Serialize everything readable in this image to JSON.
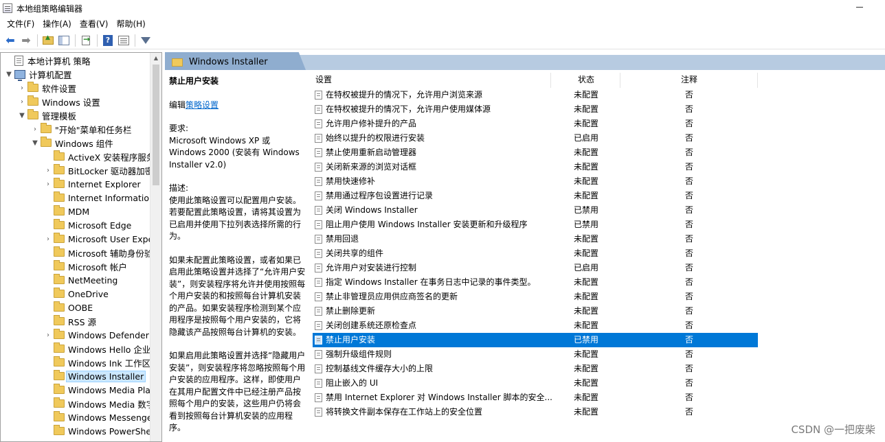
{
  "window": {
    "title": "本地组策略编辑器"
  },
  "menu": [
    "文件(F)",
    "操作(A)",
    "查看(V)",
    "帮助(H)"
  ],
  "toolbar": {
    "icons": [
      "back-arrow-icon",
      "forward-arrow-icon",
      "folder-up-icon",
      "show-hide-tree-icon",
      "export-list-icon",
      "help-icon",
      "properties-icon",
      "filter-icon"
    ]
  },
  "tree": [
    {
      "label": "本地计算机 策略",
      "icon": "doc",
      "expander": ""
    },
    {
      "label": "计算机配置",
      "icon": "pc",
      "expander": "▼"
    },
    {
      "label": "软件设置",
      "icon": "folder",
      "expander": "›"
    },
    {
      "label": "Windows 设置",
      "icon": "folder",
      "expander": "›"
    },
    {
      "label": "管理模板",
      "icon": "folder",
      "expander": "▼"
    },
    {
      "label": "\"开始\"菜单和任务栏",
      "icon": "folder",
      "expander": "›"
    },
    {
      "label": "Windows 组件",
      "icon": "folder",
      "expander": "▼"
    },
    {
      "label": "ActiveX 安装程序服务",
      "icon": "folder",
      "expander": ""
    },
    {
      "label": "BitLocker 驱动器加密",
      "icon": "folder",
      "expander": "›"
    },
    {
      "label": "Internet Explorer",
      "icon": "folder",
      "expander": "›"
    },
    {
      "label": "Internet Information",
      "icon": "folder",
      "expander": ""
    },
    {
      "label": "MDM",
      "icon": "folder",
      "expander": ""
    },
    {
      "label": "Microsoft Edge",
      "icon": "folder",
      "expander": ""
    },
    {
      "label": "Microsoft User Expe",
      "icon": "folder",
      "expander": "›"
    },
    {
      "label": "Microsoft 辅助身份验",
      "icon": "folder",
      "expander": ""
    },
    {
      "label": "Microsoft 帐户",
      "icon": "folder",
      "expander": ""
    },
    {
      "label": "NetMeeting",
      "icon": "folder",
      "expander": ""
    },
    {
      "label": "OneDrive",
      "icon": "folder",
      "expander": ""
    },
    {
      "label": "OOBE",
      "icon": "folder",
      "expander": ""
    },
    {
      "label": "RSS 源",
      "icon": "folder",
      "expander": ""
    },
    {
      "label": "Windows Defender",
      "icon": "folder",
      "expander": "›"
    },
    {
      "label": "Windows Hello 企业",
      "icon": "folder",
      "expander": ""
    },
    {
      "label": "Windows Ink 工作区",
      "icon": "folder",
      "expander": ""
    },
    {
      "label": "Windows Installer",
      "icon": "folder",
      "expander": "",
      "selected": true
    },
    {
      "label": "Windows Media Pla",
      "icon": "folder",
      "expander": ""
    },
    {
      "label": "Windows Media 数字",
      "icon": "folder",
      "expander": ""
    },
    {
      "label": "Windows Messenge",
      "icon": "folder",
      "expander": ""
    },
    {
      "label": "Windows PowerShe",
      "icon": "folder",
      "expander": ""
    }
  ],
  "header": {
    "title": "Windows Installer"
  },
  "description": {
    "policy_title": "禁止用户安装",
    "edit_prefix": "编辑",
    "edit_link": "策略设置",
    "requirements_label": "要求:",
    "requirements": "Microsoft Windows XP 或 Windows 2000 (安装有 Windows Installer v2.0)",
    "description_label": "描述:",
    "paragraphs": [
      "使用此策略设置可以配置用户安装。若要配置此策略设置，请将其设置为已启用并使用下拉列表选择所需的行为。",
      "如果未配置此策略设置，或者如果已启用此策略设置并选择了“允许用户安装”，则安装程序将允许并使用按照每个用户安装的和按照每台计算机安装的产品。如果安装程序检测到某个应用程序是按照每个用户安装的，它将隐藏该产品按照每台计算机的安装。",
      "如果启用此策略设置并选择“隐藏用户安装”，则安装程序将忽略按照每个用户安装的应用程序。这样，即使用户在其用户配置文件中已经注册产品按照每个用户的安装，这些用户仍将会看到按照每台计算机安装的应用程序。"
    ]
  },
  "list": {
    "columns": [
      "设置",
      "状态",
      "注释"
    ],
    "rows": [
      {
        "name": "在特权被提升的情况下，允许用户浏览来源",
        "state": "未配置",
        "comment": "否"
      },
      {
        "name": "在特权被提升的情况下，允许用户使用媒体源",
        "state": "未配置",
        "comment": "否"
      },
      {
        "name": "允许用户修补提升的产品",
        "state": "未配置",
        "comment": "否"
      },
      {
        "name": "始终以提升的权限进行安装",
        "state": "已启用",
        "comment": "否"
      },
      {
        "name": "禁止使用重新启动管理器",
        "state": "未配置",
        "comment": "否"
      },
      {
        "name": "关闭新来源的浏览对话框",
        "state": "未配置",
        "comment": "否"
      },
      {
        "name": "禁用快速修补",
        "state": "未配置",
        "comment": "否"
      },
      {
        "name": "禁用通过程序包设置进行记录",
        "state": "未配置",
        "comment": "否"
      },
      {
        "name": "关闭 Windows Installer",
        "state": "已禁用",
        "comment": "否"
      },
      {
        "name": "阻止用户使用 Windows Installer 安装更新和升级程序",
        "state": "已禁用",
        "comment": "否"
      },
      {
        "name": "禁用回退",
        "state": "未配置",
        "comment": "否"
      },
      {
        "name": "关闭共享的组件",
        "state": "未配置",
        "comment": "否"
      },
      {
        "name": "允许用户对安装进行控制",
        "state": "已启用",
        "comment": "否"
      },
      {
        "name": "指定 Windows Installer 在事务日志中记录的事件类型。",
        "state": "未配置",
        "comment": "否"
      },
      {
        "name": "禁止非管理员应用供应商签名的更新",
        "state": "未配置",
        "comment": "否"
      },
      {
        "name": "禁止删除更新",
        "state": "未配置",
        "comment": "否"
      },
      {
        "name": "关闭创建系统还原检查点",
        "state": "未配置",
        "comment": "否"
      },
      {
        "name": "禁止用户安装",
        "state": "已禁用",
        "comment": "否",
        "selected": true
      },
      {
        "name": "强制升级组件规则",
        "state": "未配置",
        "comment": "否"
      },
      {
        "name": "控制基线文件缓存大小的上限",
        "state": "未配置",
        "comment": "否"
      },
      {
        "name": "阻止嵌入的 UI",
        "state": "未配置",
        "comment": "否"
      },
      {
        "name": "禁用 Internet Explorer 对 Windows Installer 脚本的安全...",
        "state": "未配置",
        "comment": "否"
      },
      {
        "name": "将转换文件副本保存在工作站上的安全位置",
        "state": "未配置",
        "comment": "否"
      }
    ]
  },
  "watermark": "CSDN @一把废柴",
  "colors": {
    "selection": "#0078d7",
    "header_bar": "#b7cbe1",
    "link": "#0066cc"
  }
}
